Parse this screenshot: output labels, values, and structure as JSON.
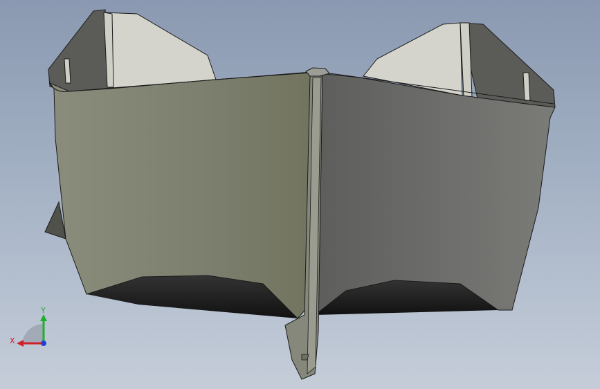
{
  "view": {
    "triad": {
      "x_label": "X",
      "y_label": "Y",
      "x_color": "#d0202a",
      "y_color": "#1fae2d",
      "z_color": "#1f3fd6"
    }
  },
  "colors": {
    "background_top": "#8a99b1",
    "background_bottom": "#c5cdd9",
    "hull_left": "#7c7f6d",
    "hull_right": "#6a6b66",
    "interior": "#d6d6d0",
    "keel": "#86897a",
    "edge": "#1a1a1a"
  }
}
